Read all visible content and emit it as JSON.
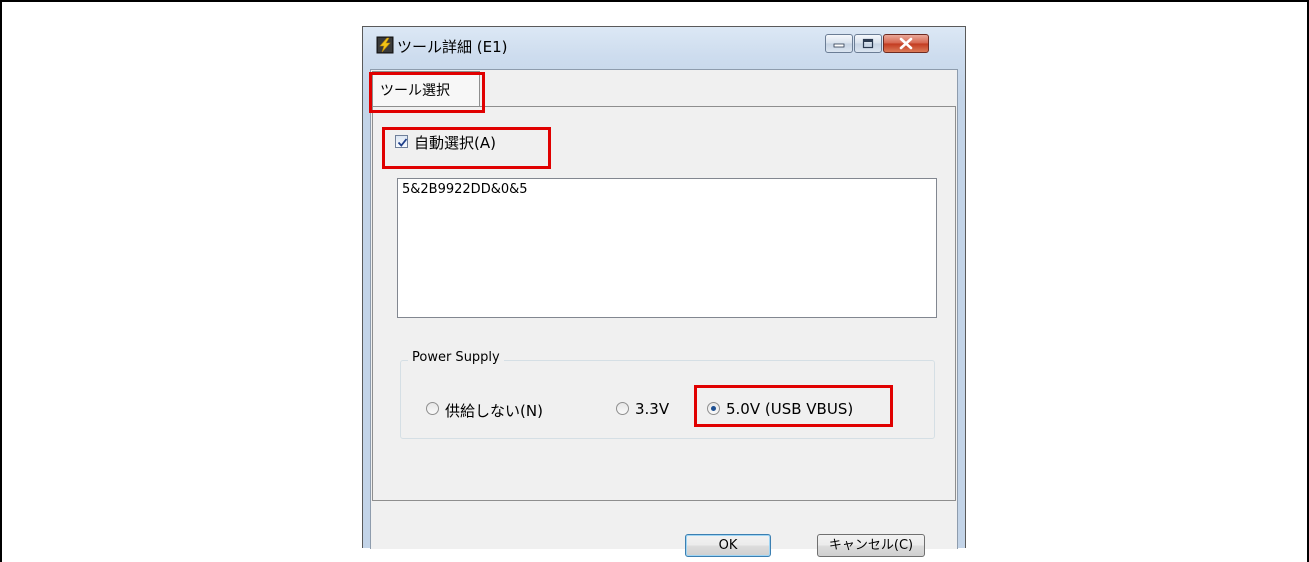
{
  "window": {
    "title": "ツール詳細 (E1)",
    "icon": "app-lightning-icon"
  },
  "tabs": [
    {
      "label": "ツール選択",
      "selected": true
    }
  ],
  "auto_select": {
    "label": "自動選択(A)",
    "checked": true
  },
  "tool_list": {
    "items": [
      "5&2B9922DD&0&5"
    ]
  },
  "power_supply": {
    "title": "Power Supply",
    "options": [
      {
        "label": "供給しない(N)",
        "selected": false
      },
      {
        "label": "3.3V",
        "selected": false
      },
      {
        "label": "5.0V (USB VBUS)",
        "selected": true
      }
    ]
  },
  "buttons": {
    "ok": "OK",
    "cancel": "キャンセル(C)"
  },
  "colors": {
    "highlight": "#e00000",
    "radio_selected": "#1d4f91",
    "close_button": "#c2391f"
  }
}
